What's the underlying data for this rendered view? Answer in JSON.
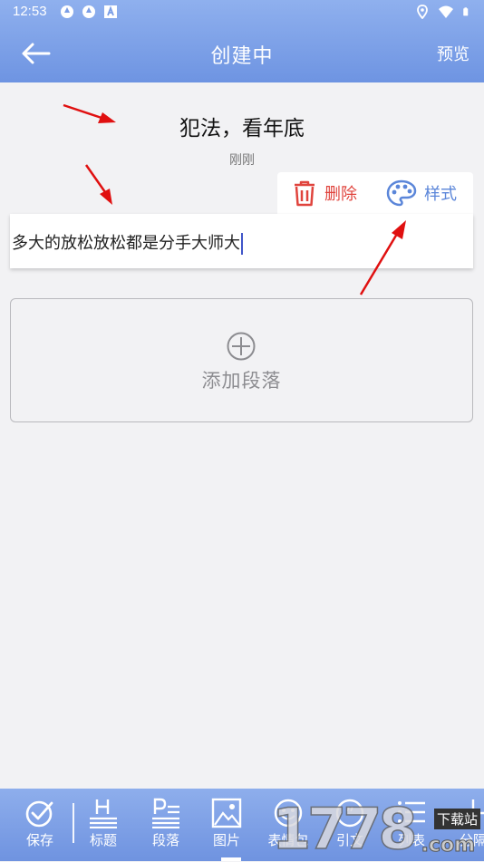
{
  "status_bar": {
    "time": "12:53"
  },
  "header": {
    "title": "创建中",
    "preview_label": "预览"
  },
  "document": {
    "title": "犯法，看年底",
    "timestamp": "刚刚"
  },
  "paragraph_actions": {
    "delete_label": "删除",
    "style_label": "样式"
  },
  "paragraph": {
    "text": "多大的放松放松都是分手大师大"
  },
  "add_paragraph": {
    "label": "添加段落"
  },
  "toolbar": {
    "items": [
      {
        "label": "保存",
        "icon": "check-circle-icon"
      },
      {
        "label": "标题",
        "icon": "heading-icon"
      },
      {
        "label": "段落",
        "icon": "paragraph-icon"
      },
      {
        "label": "图片",
        "icon": "image-icon"
      },
      {
        "label": "表情包",
        "icon": "emoji-icon"
      },
      {
        "label": "引文",
        "icon": "quote-icon"
      },
      {
        "label": "列表",
        "icon": "list-icon"
      },
      {
        "label": "分隔",
        "icon": "divider-icon"
      }
    ]
  },
  "watermark": {
    "digits": "1778",
    "site": "下载站",
    "suffix": ".com"
  },
  "colors": {
    "header": "#7a9de6",
    "delete": "#e0443d",
    "style": "#5b86d9",
    "arrow": "#e01010"
  }
}
